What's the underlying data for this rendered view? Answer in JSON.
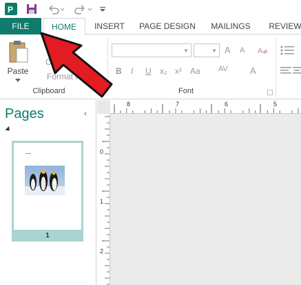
{
  "qat": {
    "app_icon": "publisher-logo-icon",
    "save_icon": "save-icon",
    "undo_icon": "undo-icon",
    "redo_icon": "redo-icon",
    "customize_icon": "customize-toolbar-icon"
  },
  "tabs": [
    {
      "label": "FILE"
    },
    {
      "label": "HOME"
    },
    {
      "label": "INSERT"
    },
    {
      "label": "PAGE DESIGN"
    },
    {
      "label": "MAILINGS"
    },
    {
      "label": "REVIEW"
    }
  ],
  "ribbon": {
    "clipboard": {
      "paste_label": "Paste",
      "copy_label": "Copy",
      "format_painter_label": "Format Pa",
      "group_label": "Clipboard"
    },
    "font": {
      "bold": "B",
      "italic": "I",
      "underline": "U",
      "subscript": "x₂",
      "superscript": "x²",
      "change_case": "Aa",
      "char_spacing": "AV",
      "font_color": "A",
      "grow_font": "A",
      "shrink_font": "A",
      "group_label": "Font"
    }
  },
  "pages_pane": {
    "title": "Pages",
    "collapse_glyph": "‹",
    "page_number": "1"
  },
  "rulers": {
    "horizontal_labels": [
      "8",
      "7",
      "6",
      "5"
    ],
    "vertical_labels": [
      "0",
      "1",
      "2"
    ]
  },
  "colors": {
    "accent": "#0f7b6c",
    "file_tab": "#0f7b6c",
    "thumb_selection": "#a9d4d0",
    "arrow": "#e31b23"
  }
}
